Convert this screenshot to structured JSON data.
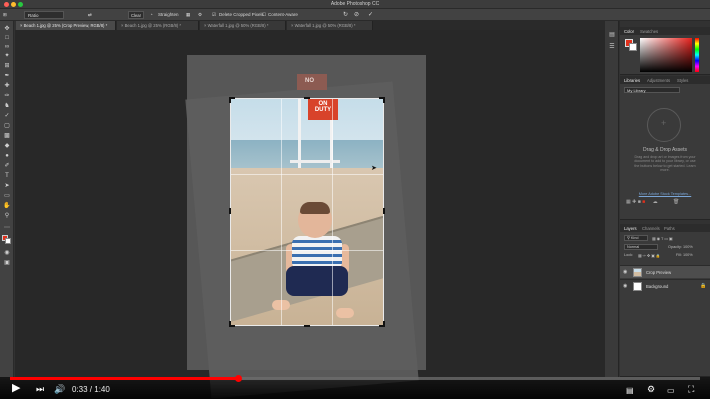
{
  "window": {
    "title": "Adobe Photoshop CC"
  },
  "options_bar": {
    "ratio_value": "Ratio",
    "clear_label": "Clear",
    "straighten_label": "Straighten",
    "delete_cropped_label": "Delete Cropped Pixels",
    "content_aware_label": "Content-Aware"
  },
  "doc_tabs": [
    {
      "label": "Beach 1.jpg @ 25% (Crop Preview, RGB/8) *",
      "active": true
    },
    {
      "label": "Beach 1.jpg @ 25% (RGB/8) *",
      "active": false
    },
    {
      "label": "Waterfall 1.jpg @ 50% (RGB/8) *",
      "active": false
    },
    {
      "label": "Waterfall 1.jpg @ 50% (RGB/8) *",
      "active": false
    }
  ],
  "tools": [
    "move-tool",
    "marquee-tool",
    "lasso-tool",
    "quick-select-tool",
    "crop-tool",
    "eyedropper-tool",
    "healing-tool",
    "brush-tool",
    "clone-stamp-tool",
    "history-brush-tool",
    "eraser-tool",
    "gradient-tool",
    "blur-tool",
    "dodge-tool",
    "pen-tool",
    "type-tool",
    "path-select-tool",
    "shape-tool",
    "hand-tool",
    "zoom-tool",
    "more-tools",
    "color-swatches",
    "quick-mask",
    "screen-mode"
  ],
  "photo_signs": {
    "top": "NO",
    "bottom_line1": "ON",
    "bottom_line2": "DUTY"
  },
  "color_panel": {
    "tabs": [
      "Color",
      "Swatches"
    ],
    "foreground": "#e0301c"
  },
  "libraries_panel": {
    "tabs": [
      "Libraries",
      "Adjustments",
      "Styles"
    ],
    "library_select": "My Library",
    "title": "Drag & Drop Assets",
    "description": "Drag and drop art or images from your document to add to your library, or use the buttons below to get started. Learn more.",
    "link": "More Adobe Stock Templates..."
  },
  "layers_panel": {
    "tabs": [
      "Layers",
      "Channels",
      "Paths"
    ],
    "kind_label": "Kind",
    "blend_mode": "Normal",
    "opacity_label": "Opacity: 100%",
    "lock_label": "Lock:",
    "fill_label": "Fill: 100%",
    "layers": [
      {
        "name": "Crop Preview",
        "selected": true
      },
      {
        "name": "Background",
        "selected": false
      }
    ]
  },
  "player": {
    "current_time": "0:33",
    "duration": "1:40",
    "time_display": "0:33 / 1:40",
    "progress_fraction": 0.33
  }
}
